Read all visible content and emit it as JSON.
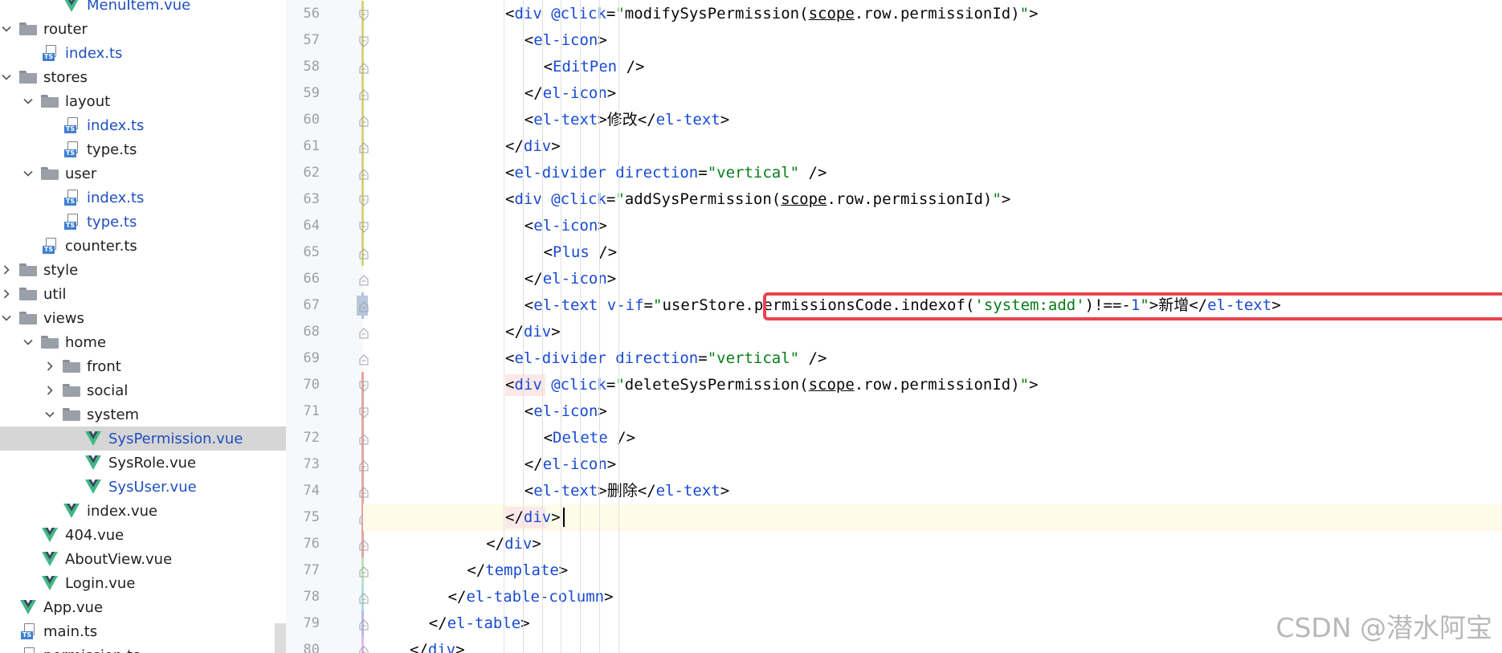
{
  "tree": {
    "items": [
      {
        "label": "MenuItem.vue",
        "type": "vue",
        "depth": 2,
        "expand": "none",
        "color": "blue"
      },
      {
        "label": "router",
        "type": "folder",
        "depth": 0,
        "expand": "open",
        "color": "normal"
      },
      {
        "label": "index.ts",
        "type": "ts",
        "depth": 1,
        "expand": "none",
        "color": "blue"
      },
      {
        "label": "stores",
        "type": "folder",
        "depth": 0,
        "expand": "open",
        "color": "normal"
      },
      {
        "label": "layout",
        "type": "folder",
        "depth": 1,
        "expand": "open",
        "color": "normal"
      },
      {
        "label": "index.ts",
        "type": "ts",
        "depth": 2,
        "expand": "none",
        "color": "blue"
      },
      {
        "label": "type.ts",
        "type": "ts",
        "depth": 2,
        "expand": "none",
        "color": "normal"
      },
      {
        "label": "user",
        "type": "folder",
        "depth": 1,
        "expand": "open",
        "color": "normal"
      },
      {
        "label": "index.ts",
        "type": "ts",
        "depth": 2,
        "expand": "none",
        "color": "blue"
      },
      {
        "label": "type.ts",
        "type": "ts",
        "depth": 2,
        "expand": "none",
        "color": "blue"
      },
      {
        "label": "counter.ts",
        "type": "ts",
        "depth": 1,
        "expand": "none",
        "color": "normal"
      },
      {
        "label": "style",
        "type": "folder",
        "depth": 0,
        "expand": "closed",
        "color": "normal"
      },
      {
        "label": "util",
        "type": "folder",
        "depth": 0,
        "expand": "closed",
        "color": "normal"
      },
      {
        "label": "views",
        "type": "folder",
        "depth": 0,
        "expand": "open",
        "color": "normal"
      },
      {
        "label": "home",
        "type": "folder",
        "depth": 1,
        "expand": "open",
        "color": "normal"
      },
      {
        "label": "front",
        "type": "folder",
        "depth": 2,
        "expand": "closed",
        "color": "normal"
      },
      {
        "label": "social",
        "type": "folder",
        "depth": 2,
        "expand": "closed",
        "color": "normal"
      },
      {
        "label": "system",
        "type": "folder",
        "depth": 2,
        "expand": "open",
        "color": "normal"
      },
      {
        "label": "SysPermission.vue",
        "type": "vue",
        "depth": 3,
        "expand": "none",
        "color": "blue",
        "selected": true
      },
      {
        "label": "SysRole.vue",
        "type": "vue",
        "depth": 3,
        "expand": "none",
        "color": "normal"
      },
      {
        "label": "SysUser.vue",
        "type": "vue",
        "depth": 3,
        "expand": "none",
        "color": "blue"
      },
      {
        "label": "index.vue",
        "type": "vue",
        "depth": 2,
        "expand": "none",
        "color": "normal"
      },
      {
        "label": "404.vue",
        "type": "vue",
        "depth": 1,
        "expand": "none",
        "color": "normal"
      },
      {
        "label": "AboutView.vue",
        "type": "vue",
        "depth": 1,
        "expand": "none",
        "color": "normal"
      },
      {
        "label": "Login.vue",
        "type": "vue",
        "depth": 1,
        "expand": "none",
        "color": "normal"
      },
      {
        "label": "App.vue",
        "type": "vue",
        "depth": 0,
        "expand": "none",
        "color": "normal"
      },
      {
        "label": "main.ts",
        "type": "ts",
        "depth": 0,
        "expand": "none",
        "color": "normal"
      },
      {
        "label": "permission.ts",
        "type": "ts",
        "depth": 0,
        "expand": "none",
        "color": "normal"
      }
    ]
  },
  "editor": {
    "lines": [
      {
        "n": "56",
        "indent": 10,
        "tokens": [
          [
            "p",
            "<"
          ],
          [
            "t",
            "div"
          ],
          [
            "p",
            " "
          ],
          [
            "a",
            "@click"
          ],
          [
            "p",
            "="
          ],
          [
            "s",
            "\""
          ],
          [
            "p",
            "modifySysPermission("
          ],
          [
            "u",
            "scope"
          ],
          [
            "p",
            ".row.permissionId)"
          ],
          [
            "s",
            "\""
          ],
          [
            "p",
            ">"
          ]
        ]
      },
      {
        "n": "57",
        "indent": 11,
        "tokens": [
          [
            "p",
            "<"
          ],
          [
            "t",
            "el-icon"
          ],
          [
            "p",
            ">"
          ]
        ]
      },
      {
        "n": "58",
        "indent": 12,
        "tokens": [
          [
            "p",
            "<"
          ],
          [
            "t",
            "EditPen"
          ],
          [
            "p",
            " />"
          ]
        ]
      },
      {
        "n": "59",
        "indent": 11,
        "tokens": [
          [
            "p",
            "</"
          ],
          [
            "t",
            "el-icon"
          ],
          [
            "p",
            ">"
          ]
        ]
      },
      {
        "n": "60",
        "indent": 11,
        "tokens": [
          [
            "p",
            "<"
          ],
          [
            "t",
            "el-text"
          ],
          [
            "p",
            ">修改</"
          ],
          [
            "t",
            "el-text"
          ],
          [
            "p",
            ">"
          ]
        ]
      },
      {
        "n": "61",
        "indent": 10,
        "tokens": [
          [
            "p",
            "</"
          ],
          [
            "t",
            "div"
          ],
          [
            "p",
            ">"
          ]
        ]
      },
      {
        "n": "62",
        "indent": 10,
        "tokens": [
          [
            "p",
            "<"
          ],
          [
            "t",
            "el-divider"
          ],
          [
            "p",
            " "
          ],
          [
            "a",
            "direction"
          ],
          [
            "p",
            "="
          ],
          [
            "s",
            "\"vertical\""
          ],
          [
            "p",
            " />"
          ]
        ]
      },
      {
        "n": "63",
        "indent": 10,
        "tokens": [
          [
            "p",
            "<"
          ],
          [
            "t",
            "div"
          ],
          [
            "p",
            " "
          ],
          [
            "a",
            "@click"
          ],
          [
            "p",
            "="
          ],
          [
            "s",
            "\""
          ],
          [
            "p",
            "addSysPermission("
          ],
          [
            "u",
            "scope"
          ],
          [
            "p",
            ".row.permissionId)"
          ],
          [
            "s",
            "\""
          ],
          [
            "p",
            ">"
          ]
        ]
      },
      {
        "n": "64",
        "indent": 11,
        "tokens": [
          [
            "p",
            "<"
          ],
          [
            "t",
            "el-icon"
          ],
          [
            "p",
            ">"
          ]
        ]
      },
      {
        "n": "65",
        "indent": 12,
        "tokens": [
          [
            "p",
            "<"
          ],
          [
            "t",
            "Plus"
          ],
          [
            "p",
            " />"
          ]
        ]
      },
      {
        "n": "66",
        "indent": 11,
        "tokens": [
          [
            "p",
            "</"
          ],
          [
            "t",
            "el-icon"
          ],
          [
            "p",
            ">"
          ]
        ]
      },
      {
        "n": "67",
        "indent": 11,
        "tokens": [
          [
            "p",
            "<"
          ],
          [
            "t",
            "el-text"
          ],
          [
            "p",
            " "
          ],
          [
            "a",
            "v-if"
          ],
          [
            "p",
            "="
          ],
          [
            "s",
            "\""
          ],
          [
            "p",
            "userStore.permissionsCode.indexof("
          ],
          [
            "s",
            "'system:add'"
          ],
          [
            "p",
            ")!==-"
          ],
          [
            "t",
            "1"
          ],
          [
            "s",
            "\""
          ],
          [
            "p",
            ">新增</"
          ],
          [
            "t",
            "el-text"
          ],
          [
            "p",
            ">"
          ]
        ]
      },
      {
        "n": "68",
        "indent": 10,
        "tokens": [
          [
            "p",
            "</"
          ],
          [
            "t",
            "div"
          ],
          [
            "p",
            ">"
          ]
        ]
      },
      {
        "n": "69",
        "indent": 10,
        "tokens": [
          [
            "p",
            "<"
          ],
          [
            "t",
            "el-divider"
          ],
          [
            "p",
            " "
          ],
          [
            "a",
            "direction"
          ],
          [
            "p",
            "="
          ],
          [
            "s",
            "\"vertical\""
          ],
          [
            "p",
            " />"
          ]
        ]
      },
      {
        "n": "70",
        "indent": 10,
        "tokens": [
          [
            "p",
            "<"
          ],
          [
            "t",
            "div"
          ],
          [
            "p",
            " "
          ],
          [
            "a",
            "@click"
          ],
          [
            "p",
            "="
          ],
          [
            "s",
            "\""
          ],
          [
            "p",
            "deleteSysPermission("
          ],
          [
            "u",
            "scope"
          ],
          [
            "p",
            ".row.permissionId)"
          ],
          [
            "s",
            "\""
          ],
          [
            "p",
            ">"
          ]
        ]
      },
      {
        "n": "71",
        "indent": 11,
        "tokens": [
          [
            "p",
            "<"
          ],
          [
            "t",
            "el-icon"
          ],
          [
            "p",
            ">"
          ]
        ]
      },
      {
        "n": "72",
        "indent": 12,
        "tokens": [
          [
            "p",
            "<"
          ],
          [
            "t",
            "Delete"
          ],
          [
            "p",
            " />"
          ]
        ]
      },
      {
        "n": "73",
        "indent": 11,
        "tokens": [
          [
            "p",
            "</"
          ],
          [
            "t",
            "el-icon"
          ],
          [
            "p",
            ">"
          ]
        ]
      },
      {
        "n": "74",
        "indent": 11,
        "tokens": [
          [
            "p",
            "<"
          ],
          [
            "t",
            "el-text"
          ],
          [
            "p",
            ">删除</"
          ],
          [
            "t",
            "el-text"
          ],
          [
            "p",
            ">"
          ]
        ]
      },
      {
        "n": "75",
        "indent": 10,
        "tokens": [
          [
            "p",
            "</"
          ],
          [
            "t",
            "div"
          ],
          [
            "p",
            ">"
          ]
        ]
      },
      {
        "n": "76",
        "indent": 9,
        "tokens": [
          [
            "p",
            "</"
          ],
          [
            "t",
            "div"
          ],
          [
            "p",
            ">"
          ]
        ]
      },
      {
        "n": "77",
        "indent": 8,
        "tokens": [
          [
            "p",
            "</"
          ],
          [
            "t",
            "template"
          ],
          [
            "p",
            ">"
          ]
        ]
      },
      {
        "n": "78",
        "indent": 7,
        "tokens": [
          [
            "p",
            "</"
          ],
          [
            "t",
            "el-table-column"
          ],
          [
            "p",
            ">"
          ]
        ]
      },
      {
        "n": "79",
        "indent": 6,
        "tokens": [
          [
            "p",
            "</"
          ],
          [
            "t",
            "el-table"
          ],
          [
            "p",
            ">"
          ]
        ]
      },
      {
        "n": "80",
        "indent": 5,
        "tokens": [
          [
            "p",
            "</"
          ],
          [
            "t",
            "div"
          ],
          [
            "p",
            ">"
          ]
        ]
      }
    ]
  },
  "watermark": "CSDN @潜水阿宝",
  "colors": {
    "tag": "#174ad4",
    "attr": "#174ad4",
    "string": "#067d17",
    "highlight_border": "#e8434f",
    "current_line": "#fefbe8",
    "selected_row": "#d6d6d6"
  }
}
